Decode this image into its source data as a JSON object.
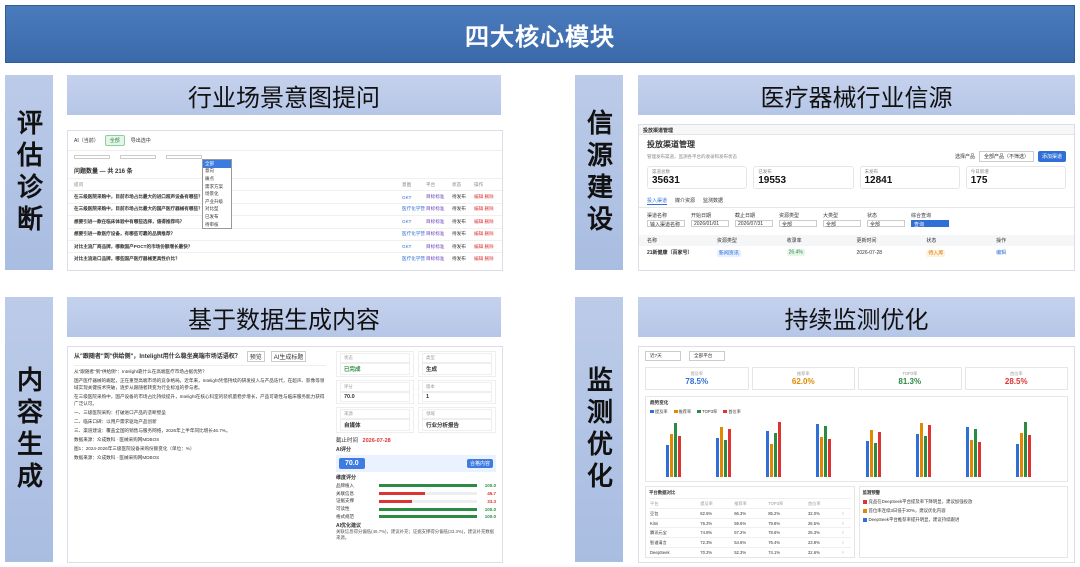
{
  "title": "四大核心模块",
  "labels": {
    "left_top": "评估诊断",
    "left_bottom": "内容生成",
    "right_top": "信源建设",
    "right_bottom": "监测优化"
  },
  "panels": {
    "p1": "行业场景意图提问",
    "p2": "医疗器械行业信源",
    "p3": "基于数据生成内容",
    "p4": "持续监测优化"
  },
  "shot1": {
    "tab": "AI（当前）",
    "filters": [
      "全部",
      "导出选中"
    ],
    "count_label": "问题数量 — 共 216 条",
    "dropdown": [
      "全部",
      "意向",
      "痛点",
      "需求方案",
      "场景化",
      "产业升级",
      "对比型",
      "已发布",
      "待审核"
    ],
    "columns": [
      "提问",
      "意图",
      "平台",
      "状态",
      "操作"
    ],
    "rows": [
      {
        "q": "在三级医院采购中，目前市场占比最大的进口超声设备有哪些？",
        "c": "GKT",
        "p": "目标标准",
        "s": "待发布",
        "a": "编辑  删除"
      },
      {
        "q": "在三级医院采购中，目前市场占比最大的国产医疗器械有哪些？",
        "c": "医疗化学营",
        "p": "目标标准",
        "s": "待发布",
        "a": "编辑  删除"
      },
      {
        "q": "想要引进一款在临床体验中有哪些选择，值得推荐吗？",
        "c": "GKT",
        "p": "目标标准",
        "s": "待发布",
        "a": "编辑  删除"
      },
      {
        "q": "想要引进一款医疗设备，有哪些可靠的品牌推荐？",
        "c": "医疗化学营",
        "p": "目标标准",
        "s": "待发布",
        "a": "编辑  删除"
      },
      {
        "q": "对比主流厂商品牌，哪款国产POCT的市场份额增长最快？",
        "c": "GKT",
        "p": "目标标准",
        "s": "待发布",
        "a": "编辑  删除"
      },
      {
        "q": "对比主流进口品牌，哪些国产医疗器械更具性价比？",
        "c": "医疗化学营",
        "p": "目标标准",
        "s": "待发布",
        "a": "编辑  删除"
      }
    ]
  },
  "shot2": {
    "bar": "投放渠道管理",
    "heading": "投放渠道管理",
    "subheading": "管理发布渠道，监测各平台的收录和发布状态",
    "product_label": "选择产品",
    "product_value": "全部产品（不筛选）",
    "add_button": "添加渠道",
    "stats": [
      {
        "label": "渠道总数",
        "value": "35631"
      },
      {
        "label": "已发布",
        "value": "19553"
      },
      {
        "label": "未发布",
        "value": "12841"
      },
      {
        "label": "今日新增",
        "value": "175"
      }
    ],
    "tabs": [
      "投入渠道",
      "媒介资源",
      "监测数据"
    ],
    "form": [
      "渠道名称",
      "开始日期",
      "截止日期",
      "资源类型",
      "大类型",
      "状态",
      "综合查询"
    ],
    "form_values": [
      "输入渠道名称",
      "2026/01/01",
      "2026/07/31",
      "全部",
      "全部",
      "全部",
      "查询"
    ],
    "table_head": [
      "名称",
      "资源类型",
      "收录率",
      "更新时间",
      "状态",
      "操作"
    ],
    "table_row": {
      "name": "21新健康（百家号）",
      "type": "新闻资讯",
      "rate": "26.4%",
      "time": "2026-07-28",
      "status": "待入库",
      "op": "编辑"
    }
  },
  "shot3": {
    "title": "从\"跟随者\"到\"供给侧\"，Intelight用什么稳坐高端市场话语权？",
    "btn1": "预览",
    "btn2": "AI生成标题",
    "paragraphs": [
      "从\"跟随者\"到\"供给侧\"：Intelight靠什么在高端医疗市场占据优势？",
      "国产医疗器械的崛起，正在重塑高端市场的竞争格局。近年来，Intelight凭借持续的研发投入与产品迭代，在超声、影像等领域实现关键技术突破，逐步从跟随者转变为行业标准的参与者。",
      "在三级医院采购中，国产设备的市场占比持续提升，Intelight在核心科室的装机量稳步增长，产品可靠性与临床服务能力获得广泛认可。",
      "一、三级医院采购：打破进口产品的垄断壁垒",
      "二、临床口碑：以用户需求驱动产品创新",
      "三、渠道建设：覆盖全国的销售与服务网络，2026年上半年同比增长46.7%。",
      "数据来源：众成数科 · 医械采购网MDBOS",
      "图1：2024-2026年三级医院设备采购份额变化（单位：%）",
      "数据来源：众成数科 · 医械采购网MDBOS"
    ],
    "kv": [
      {
        "label": "状态",
        "value": "已完成"
      },
      {
        "label": "类型",
        "value": "生成"
      },
      {
        "label": "评分",
        "value": "70.0"
      },
      {
        "label": "版本",
        "value": "1"
      },
      {
        "label": "来源",
        "value": "自媒体"
      },
      {
        "label": "领域",
        "value": "行业分析报告"
      }
    ],
    "deadline_label": "截止时间",
    "deadline": "2026-07-28",
    "score_title": "AI评分",
    "score": "70.0",
    "score_tag": "合格内容",
    "dims_title": "维度评分",
    "dims": [
      {
        "name": "品牌植入",
        "value": "100.0",
        "pct": 1.0,
        "color": "#2c8a43"
      },
      {
        "name": "关联信息",
        "value": "46.7",
        "pct": 0.467,
        "color": "#d33"
      },
      {
        "name": "证据支撑",
        "value": "33.3",
        "pct": 0.333,
        "color": "#d33"
      },
      {
        "name": "可读性",
        "value": "100.0",
        "pct": 1.0,
        "color": "#2c8a43"
      },
      {
        "name": "格式规范",
        "value": "100.0",
        "pct": 1.0,
        "color": "#2c8a43"
      }
    ],
    "advice_title": "AI优化建议",
    "advice": "关联信息得分偏低(46.7%)，建议补充；证据支撑得分偏低(33.3%)，建议补充数据来源。"
  },
  "shot4": {
    "filters": [
      "近7天",
      "全部平台"
    ],
    "kpis": [
      {
        "label": "提及率",
        "value": "78.5%",
        "color": "#2f6fd6"
      },
      {
        "label": "推荐率",
        "value": "62.0%",
        "color": "#e08a00"
      },
      {
        "label": "TOP3率",
        "value": "81.3%",
        "color": "#2c8a43"
      },
      {
        "label": "首位率",
        "value": "28.5%",
        "color": "#d33"
      }
    ],
    "chart_title": "趋势变化",
    "legend": [
      {
        "name": "提及率",
        "color": "#2f6fd6"
      },
      {
        "name": "推荐率",
        "color": "#e08a00"
      },
      {
        "name": "TOP3率",
        "color": "#2c8a43"
      },
      {
        "name": "首位率",
        "color": "#d33"
      }
    ],
    "table_title": "平台数据对比",
    "table_head": [
      "平台",
      "提及率",
      "推荐率",
      "TOP3率",
      "首位率",
      ""
    ],
    "table_rows": [
      [
        "豆包",
        "82.5%",
        "66.3%",
        "85.2%",
        "32.0%",
        "↑"
      ],
      [
        "Kimi",
        "76.2%",
        "59.6%",
        "79.8%",
        "26.5%",
        "↑"
      ],
      [
        "腾讯元宝",
        "74.8%",
        "57.2%",
        "78.6%",
        "25.3%",
        "↑"
      ],
      [
        "智谱清言",
        "72.3%",
        "54.6%",
        "76.4%",
        "23.8%",
        "↑"
      ],
      [
        "DeepSeek",
        "70.2%",
        "52.3%",
        "74.1%",
        "22.6%",
        "↑"
      ]
    ],
    "alerts_title": "监测预警",
    "alerts": [
      {
        "text": "竞品在DeepSeek平台提及率下降明显，建议加强投放",
        "color": "#d33"
      },
      {
        "text": "首位率连续3日低于30%，建议优化内容",
        "color": "#e08a00"
      },
      {
        "text": "DeepSeek平台推荐率提升明显，建议持续跟进",
        "color": "#2f6fd6"
      }
    ]
  }
}
